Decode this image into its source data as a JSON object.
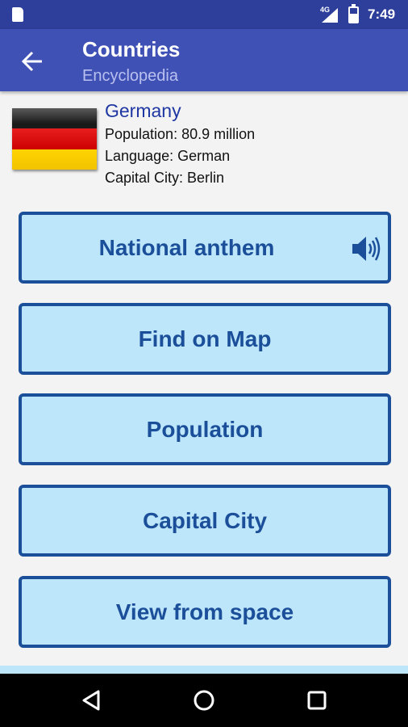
{
  "status_bar": {
    "network": "4G",
    "time": "7:49"
  },
  "app_bar": {
    "title": "Countries",
    "subtitle": "Encyclopedia"
  },
  "country": {
    "name": "Germany",
    "population": "Population: 80.9 million",
    "language": "Language: German",
    "capital": "Capital City: Berlin",
    "flag_colors": [
      "#000000",
      "#dd0000",
      "#ffce00"
    ]
  },
  "buttons": {
    "anthem": "National anthem",
    "map": "Find on Map",
    "population": "Population",
    "capital": "Capital City",
    "space": "View from space"
  },
  "colors": {
    "status_bar": "#2d3f9a",
    "app_bar": "#3f51b5",
    "button_fill": "#bee6fa",
    "button_border": "#1b4f9a",
    "country_name": "#1f37a3"
  },
  "icons": {
    "back": "arrow-left-icon",
    "anthem": "speaker-icon",
    "nav": [
      "back-triangle-icon",
      "home-circle-icon",
      "recents-square-icon"
    ]
  }
}
